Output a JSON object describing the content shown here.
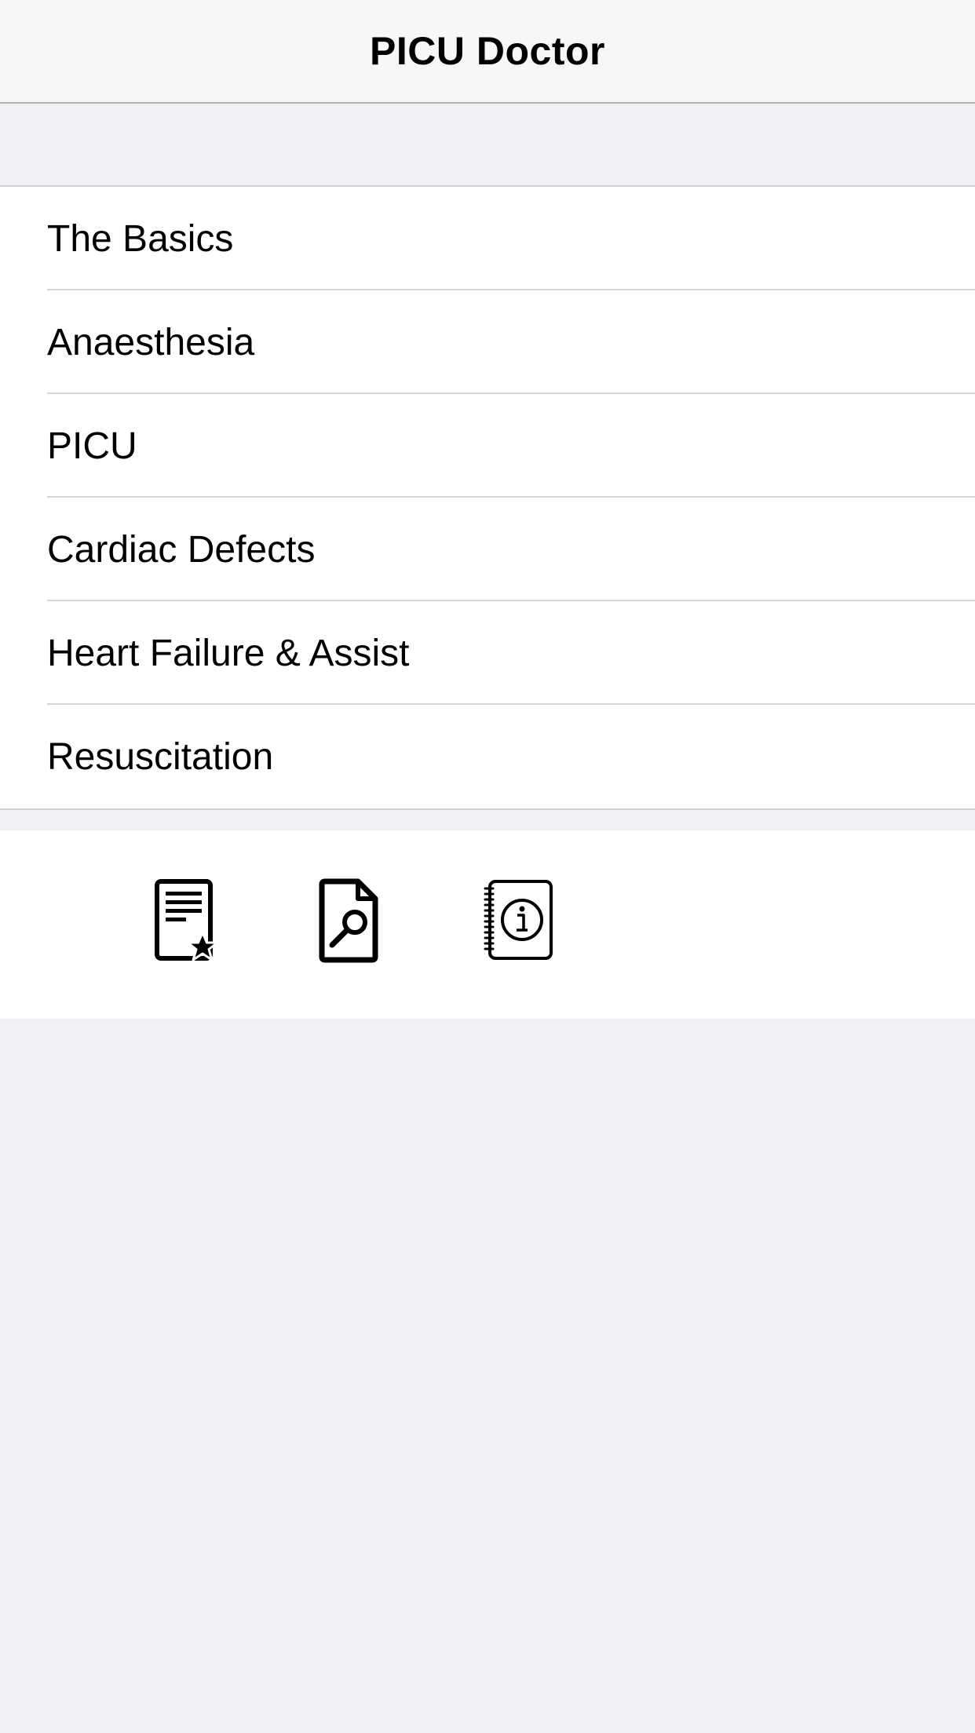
{
  "header": {
    "title": "PICU Doctor"
  },
  "menu": {
    "items": [
      {
        "label": "The Basics"
      },
      {
        "label": "Anaesthesia"
      },
      {
        "label": "PICU"
      },
      {
        "label": "Cardiac Defects"
      },
      {
        "label": "Heart Failure & Assist"
      },
      {
        "label": "Resuscitation"
      }
    ]
  },
  "toolbar": {
    "icons": [
      "favorites-document-icon",
      "search-document-icon",
      "info-notebook-icon"
    ]
  },
  "colors": {
    "background": "#efeff4",
    "navbar": "#f7f7f7",
    "separator": "#d6d6d8"
  }
}
